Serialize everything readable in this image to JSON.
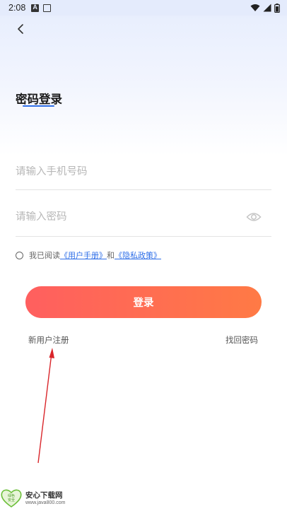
{
  "status_bar": {
    "time": "2:08"
  },
  "page": {
    "title": "密码登录"
  },
  "form": {
    "phone_placeholder": "请输入手机号码",
    "password_placeholder": "请输入密码"
  },
  "agreement": {
    "prefix": "我已阅读",
    "user_manual": "《用户手册》",
    "conjunction": "和",
    "privacy_policy": "《隐私政策》"
  },
  "actions": {
    "login_label": "登录",
    "register_label": "新用户注册",
    "forgot_label": "找回密码"
  },
  "watermark": {
    "name": "安心下载网",
    "url": "www.java800.com",
    "logo_text": [
      "绿色",
      "安全"
    ]
  },
  "colors": {
    "accent_blue": "#2f6fe8",
    "button_gradient_start": "#ff5f5f",
    "button_gradient_end": "#ff7a45",
    "annotation_arrow": "#d9252a"
  }
}
